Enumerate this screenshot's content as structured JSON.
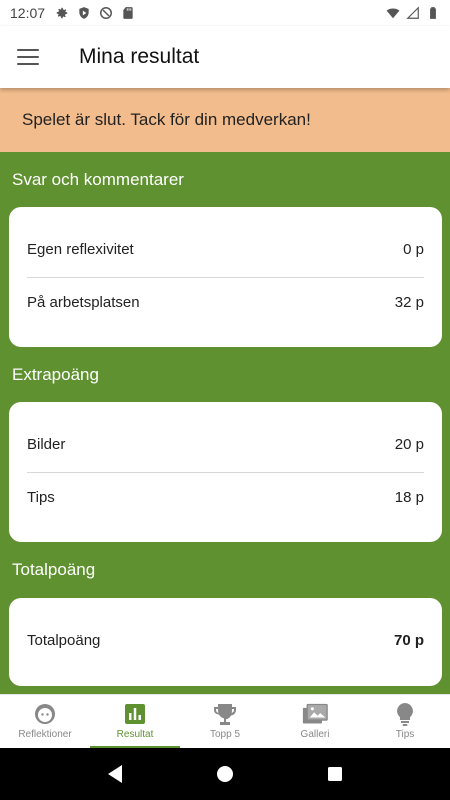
{
  "status_bar": {
    "time": "12:07",
    "left_icons": [
      "settings-icon",
      "shield-play-icon",
      "no-disturb-icon",
      "sd-card-icon"
    ],
    "right_icons": [
      "wifi-icon",
      "signal-icon",
      "battery-icon"
    ]
  },
  "app_bar": {
    "title": "Mina resultat",
    "menu_icon": "hamburger-menu-icon"
  },
  "banner": {
    "text": "Spelet är slut. Tack för din medverkan!",
    "color": "#f2bc8c"
  },
  "sections": {
    "answers": {
      "title": "Svar och kommentarer",
      "rows": [
        {
          "label": "Egen reflexivitet",
          "value": "0 p"
        },
        {
          "label": "På arbetsplatsen",
          "value": "32 p"
        }
      ]
    },
    "extra": {
      "title": "Extrapoäng",
      "rows": [
        {
          "label": "Bilder",
          "value": "20 p"
        },
        {
          "label": "Tips",
          "value": "18 p"
        }
      ]
    },
    "total": {
      "title": "Totalpoäng",
      "rows": [
        {
          "label": "Totalpoäng",
          "value": "70 p"
        }
      ]
    }
  },
  "bottom_nav": {
    "items": [
      {
        "label": "Reflektioner",
        "icon": "face-icon",
        "active": false
      },
      {
        "label": "Resultat",
        "icon": "bar-chart-icon",
        "active": true
      },
      {
        "label": "Topp 5",
        "icon": "trophy-icon",
        "active": false
      },
      {
        "label": "Galleri",
        "icon": "gallery-icon",
        "active": false
      },
      {
        "label": "Tips",
        "icon": "lightbulb-icon",
        "active": false
      }
    ]
  },
  "colors": {
    "accent": "#5f9130",
    "background": "#5f9130",
    "banner": "#f2bc8c"
  }
}
